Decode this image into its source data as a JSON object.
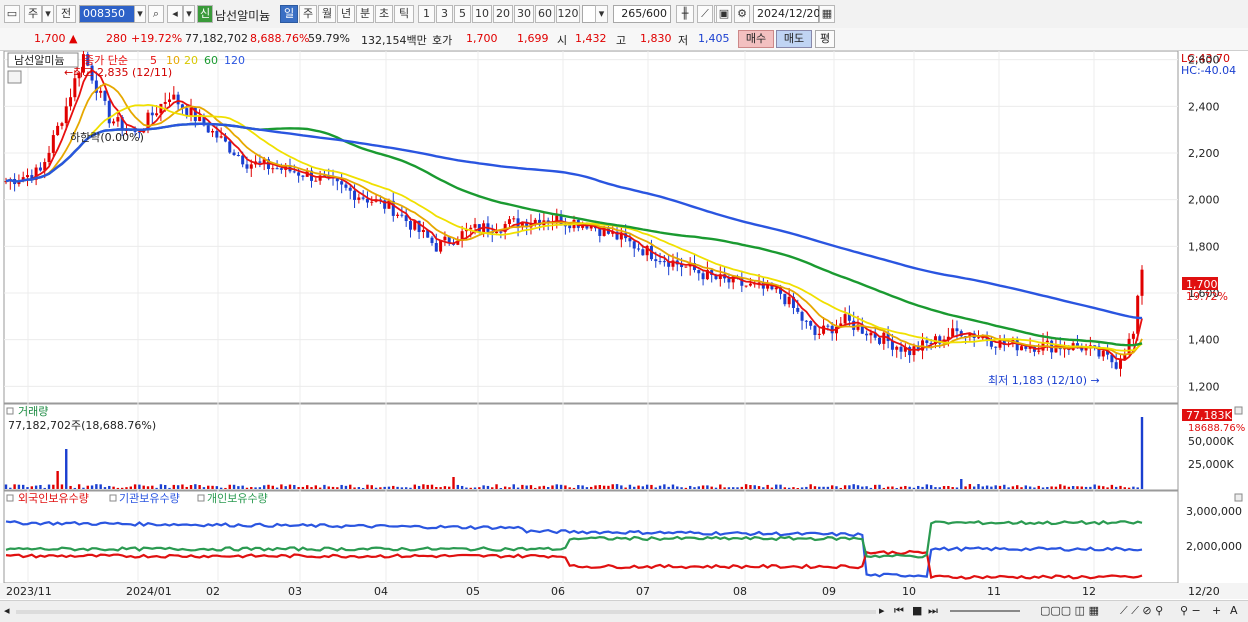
{
  "toolbar": {
    "market_label": "주",
    "prev_label": "전",
    "code_value": "008350",
    "stock_name": "남선알미늄",
    "badge_new": "신",
    "periods": [
      "일",
      "주",
      "월",
      "년",
      "분",
      "초",
      "틱"
    ],
    "active_period": "일",
    "intervals": [
      "1",
      "3",
      "5",
      "10",
      "20",
      "30",
      "60",
      "120"
    ],
    "count_value": "265",
    "count_max": "/600",
    "date_value": "2024/12/20"
  },
  "quote": {
    "price": "1,700",
    "change_arrow": "▲",
    "change": "280",
    "change_pct": "+19.72%",
    "volume": "77,182,702",
    "volume_ratio": "8,688.76%",
    "turnover": "59.79%",
    "amount": "132,154백만",
    "hoga_label": "호가",
    "ask": "1,700",
    "bid": "1,699",
    "open_label": "시",
    "open": "1,432",
    "high_label": "고",
    "high": "1,830",
    "low_label": "저",
    "low": "1,405",
    "buy_label": "매수",
    "sell_label": "매도",
    "eval_label": "평"
  },
  "price_panel": {
    "legend_name": "남선알미늄",
    "legend_ma": "종가 단순",
    "ma_periods": [
      "5",
      "10",
      "20",
      "60",
      "120"
    ],
    "ma_colors": [
      "#e81010",
      "#e6a800",
      "#f0e000",
      "#1a9a30",
      "#2a55e0"
    ],
    "high_annotation": "최고 2,835 (12/11)",
    "low_annotation": "최저 1,183 (12/10)",
    "limit_down_annotation": "하한락(0.00%)",
    "lc_label": "LC:43.70",
    "hc_label": "HC:-40.04",
    "current_price_tag": "1,700",
    "current_pct_tag": "19.72%",
    "y_ticks": [
      "2,600",
      "2,400",
      "2,200",
      "2,000",
      "1,800",
      "1,600",
      "1,400",
      "1,200"
    ]
  },
  "volume_panel": {
    "title": "거래량",
    "value_text": "77,182,702주(18,688.76%)",
    "tag_value": "77,183K",
    "tag_pct": "18688.76%",
    "y_ticks": [
      "50,000K",
      "25,000K"
    ]
  },
  "holdings_panel": {
    "legend": [
      "외국인보유수량",
      "기관보유수량",
      "개인보유수량"
    ],
    "colors": [
      "#e01010",
      "#2a55e0",
      "#2a9a50"
    ],
    "y_ticks": [
      "3,000,000",
      "2,000,000"
    ]
  },
  "x_axis": {
    "labels": [
      "2023/11",
      "2024/01",
      "02",
      "03",
      "04",
      "05",
      "06",
      "07",
      "08",
      "09",
      "10",
      "11",
      "12"
    ],
    "right_label": "12/20"
  },
  "colors": {
    "up": "#e00000",
    "down": "#1a3fd0",
    "accent": "#3a6fc4"
  },
  "chart_data": {
    "type": "line",
    "title": "",
    "y_ticks": [
      1200,
      1400,
      1600,
      1800,
      2000,
      2200,
      2400,
      2600
    ],
    "series_low_high": {
      "high": 2835,
      "low": 1183
    },
    "last_price": 1700
  }
}
